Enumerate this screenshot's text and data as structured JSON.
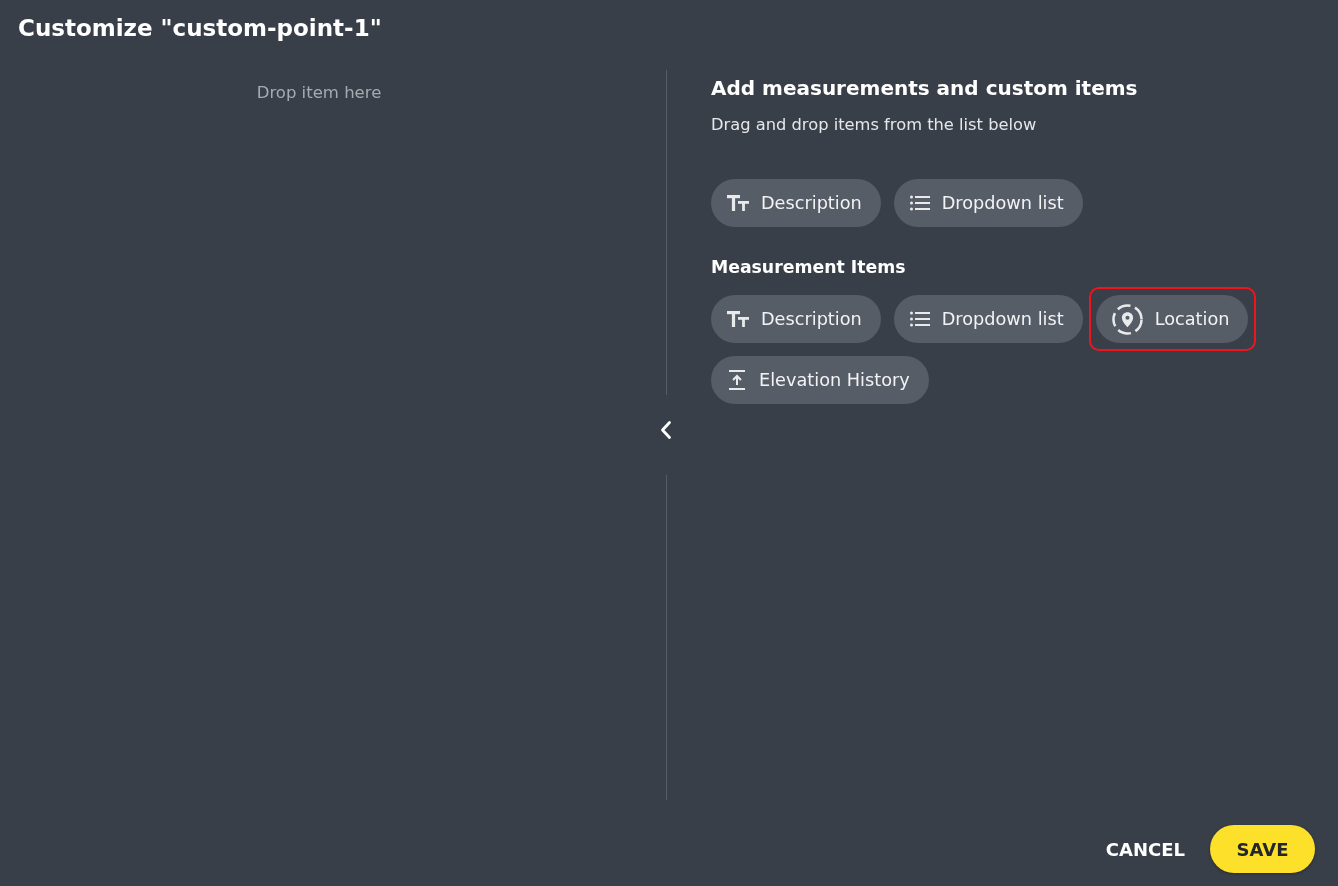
{
  "dialog": {
    "title": "Customize \"custom-point-1\""
  },
  "drop_zone": {
    "hint": "Drop item here"
  },
  "palette": {
    "heading": "Add measurements and custom items",
    "subheading": "Drag and drop items from the list below",
    "custom_items": [
      {
        "kind": "text",
        "label": "Description",
        "highlighted": false
      },
      {
        "kind": "list",
        "label": "Dropdown list",
        "highlighted": false
      }
    ],
    "measurement_section": {
      "heading": "Measurement Items",
      "items": [
        {
          "kind": "text",
          "label": "Description",
          "highlighted": false
        },
        {
          "kind": "list",
          "label": "Dropdown list",
          "highlighted": false
        },
        {
          "kind": "location",
          "label": "Location",
          "highlighted": true
        },
        {
          "kind": "elevation",
          "label": "Elevation History",
          "highlighted": false
        }
      ]
    }
  },
  "footer": {
    "buttons": [
      {
        "kind": "text",
        "label": "CANCEL"
      },
      {
        "kind": "primary",
        "label": "SAVE"
      }
    ]
  }
}
